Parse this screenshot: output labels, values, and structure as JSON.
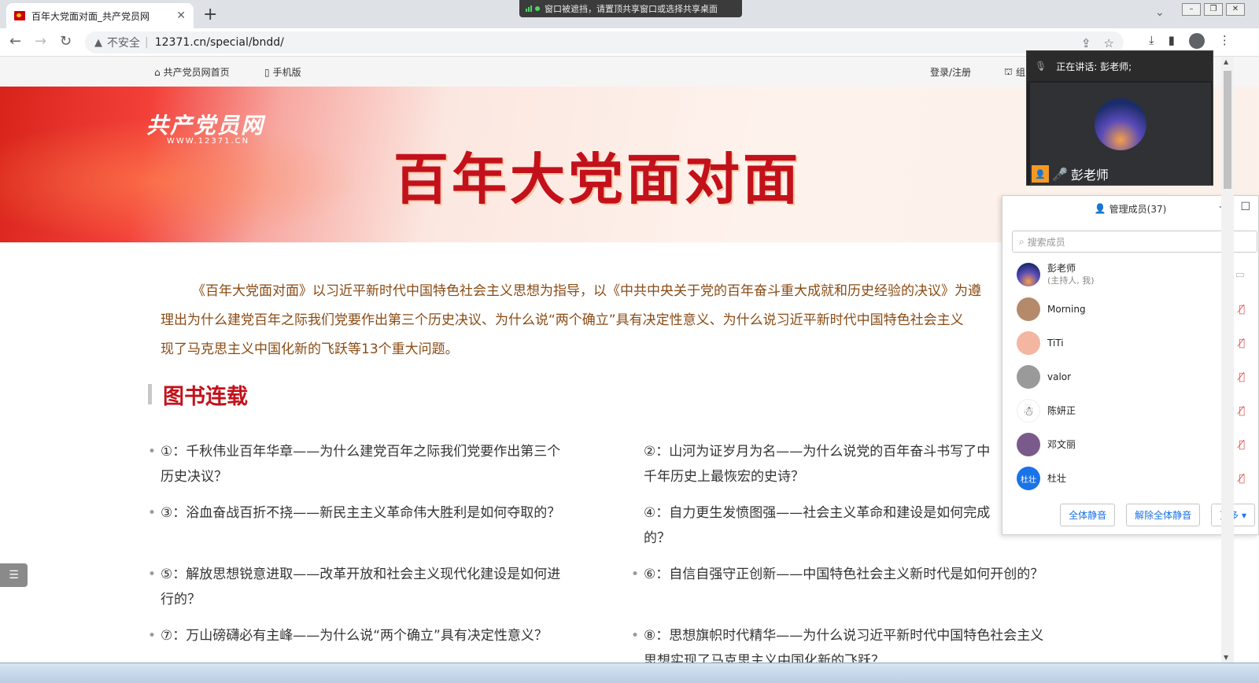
{
  "browser": {
    "tab_title": "百年大党面对面_共产党员网",
    "tab_close": "✕",
    "new_tab": "+",
    "share_banner": "窗口被遮挡，请置顶共享窗口或选择共享桌面",
    "insecure_label": "不安全",
    "url": "12371.cn/special/bndd/"
  },
  "site_nav": {
    "home": "共产党员网首页",
    "mobile": "手机版",
    "login": "登录/注册",
    "org_partial": "组"
  },
  "banner": {
    "logo_text": "共产党员网",
    "logo_url": "WWW.12371.CN",
    "headline": "百年大党面对面"
  },
  "intro": {
    "lines": [
      "《百年大党面对面》以习近平新时代中国特色社会主义思想为指导，以《中共中央关于党的百年奋斗重大成就和历史经验的决议》为遵",
      "理出为什么建党百年之际我们党要作出第三个历史决议、为什么说“两个确立”具有决定性意义、为什么说习近平新时代中国特色社会主义",
      "现了马克思主义中国化新的飞跃等13个重大问题。"
    ]
  },
  "section": {
    "title": "图书连载"
  },
  "chapters": [
    {
      "line1": "①：千秋伟业百年华章——为什么建党百年之际我们党要作出第三个",
      "line2": "历史决议？"
    },
    {
      "line1": "②：山河为证岁月为名——为什么说党的百年奋斗书写了中",
      "line2": "千年历史上最恢宏的史诗？"
    },
    {
      "line1": "③：浴血奋战百折不挠——新民主主义革命伟大胜利是如何夺取的？",
      "line2": ""
    },
    {
      "line1": "④：自力更生发愤图强——社会主义革命和建设是如何完成",
      "line2": "的？"
    },
    {
      "line1": "⑤：解放思想锐意进取——改革开放和社会主义现代化建设是如何进",
      "line2": "行的？"
    },
    {
      "line1": "⑥：自信自强守正创新——中国特色社会主义新时代是如何开创的？",
      "line2": ""
    },
    {
      "line1": "⑦：万山磅礴必有主峰——为什么说“两个确立”具有决定性意义？",
      "line2": ""
    },
    {
      "line1": "⑧：思想旗帜时代精华——为什么说习近平新时代中国特色社会主义",
      "line2": "思想实现了马克思主义中国化新的飞跃？"
    }
  ],
  "meeting": {
    "speaking_label": "正在讲话: 彭老师;",
    "speaker_name": "彭老师",
    "members_title": "管理成员(37)",
    "search_placeholder": "搜索成员",
    "members": [
      {
        "name": "彭老师",
        "sub": "(主持人, 我)",
        "color": "#2b3a6e"
      },
      {
        "name": "Morning",
        "sub": "",
        "color": "#b58a6a"
      },
      {
        "name": "TiTi",
        "sub": "",
        "color": "#f3b6a0"
      },
      {
        "name": "valor",
        "sub": "",
        "color": "#9a9a9a"
      },
      {
        "name": "陈妍正",
        "sub": "",
        "color": "#ffffff"
      },
      {
        "name": "邓文丽",
        "sub": "",
        "color": "#7a5a8a"
      },
      {
        "name": "杜壮",
        "sub": "",
        "color": "#1a73e8",
        "initials": "杜壮"
      }
    ],
    "mute_all": "全体静音",
    "unmute_all": "解除全体静音",
    "more": "更多 ▾"
  }
}
